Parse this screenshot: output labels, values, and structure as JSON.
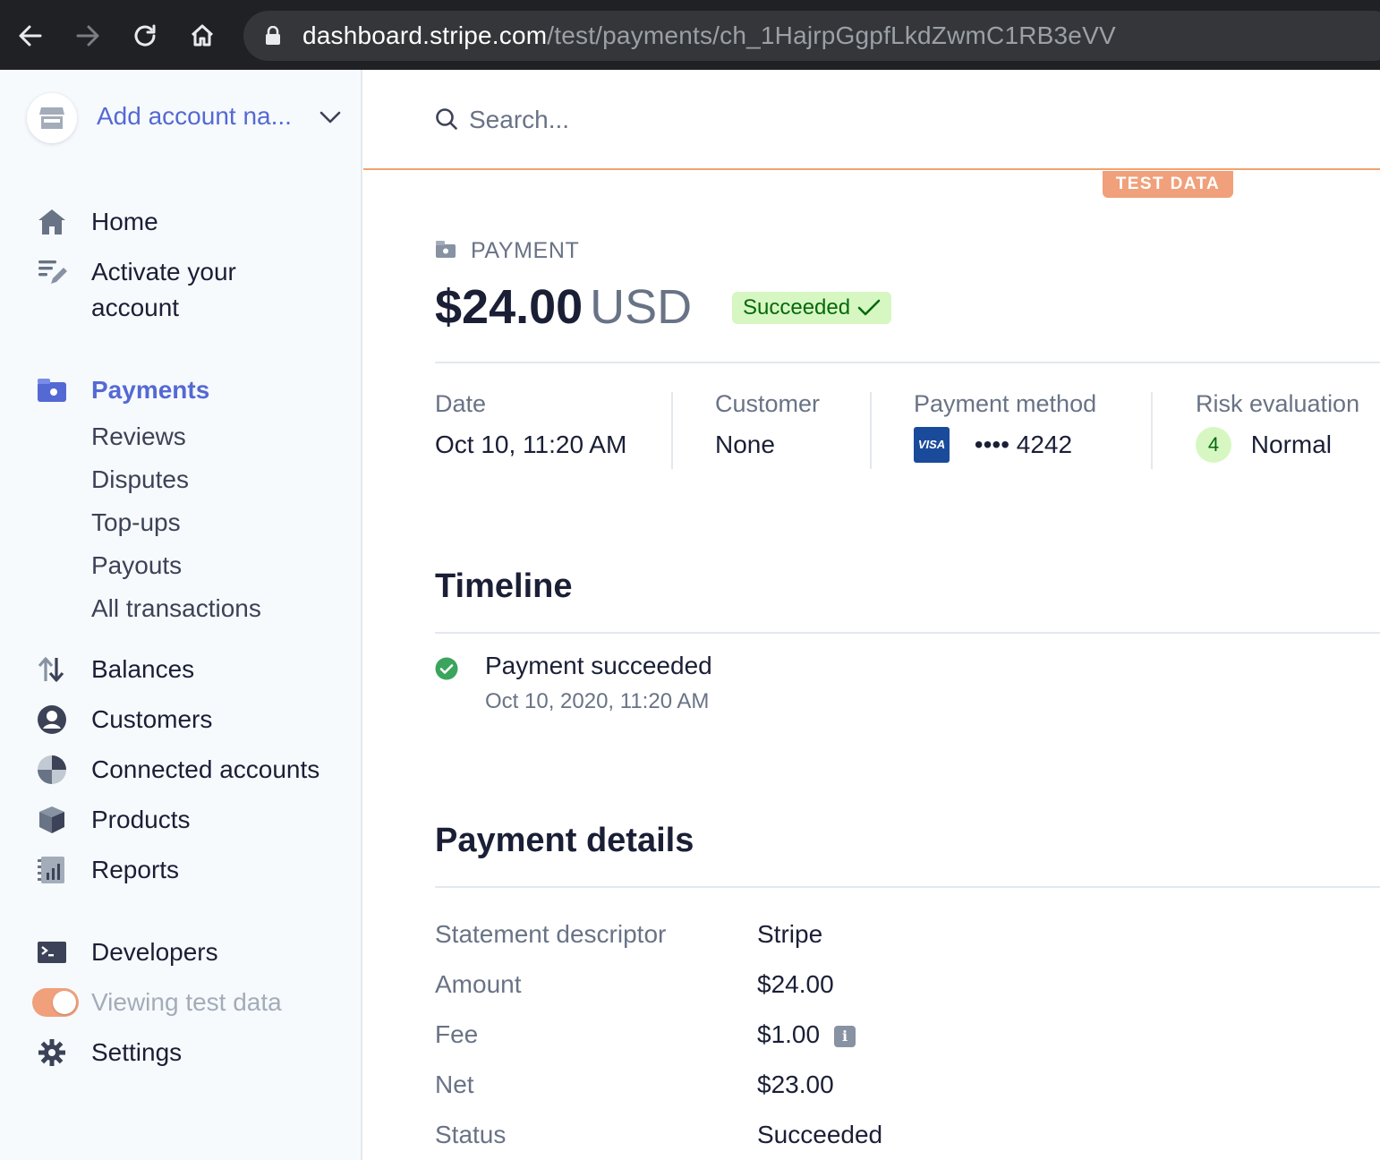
{
  "browser": {
    "url_host": "dashboard.stripe.com",
    "url_path": "/test/payments/ch_1HajrpGgpfLkdZwmC1RB3eVV"
  },
  "sidebar": {
    "account_name": "Add account na...",
    "items": {
      "home": "Home",
      "activate_line1": "Activate your",
      "activate_line2": "account",
      "payments": "Payments",
      "balances": "Balances",
      "customers": "Customers",
      "connected_accounts": "Connected accounts",
      "products": "Products",
      "reports": "Reports",
      "developers": "Developers",
      "viewing_test_data": "Viewing test data",
      "settings": "Settings"
    },
    "payments_sub": {
      "reviews": "Reviews",
      "disputes": "Disputes",
      "topups": "Top-ups",
      "payouts": "Payouts",
      "all_transactions": "All transactions"
    },
    "test_data_toggle_on": true
  },
  "search": {
    "placeholder": "Search..."
  },
  "test_badge": "TEST DATA",
  "payment": {
    "label": "PAYMENT",
    "amount": "$24.00",
    "currency": "USD",
    "status": "Succeeded"
  },
  "summary": {
    "date_label": "Date",
    "date_value": "Oct 10, 11:20 AM",
    "customer_label": "Customer",
    "customer_value": "None",
    "method_label": "Payment method",
    "card_brand": "VISA",
    "card_last4": "•••• 4242",
    "risk_label": "Risk evaluation",
    "risk_score": "4",
    "risk_value": "Normal"
  },
  "timeline": {
    "title": "Timeline",
    "event_title": "Payment succeeded",
    "event_date": "Oct 10, 2020, 11:20 AM"
  },
  "details": {
    "title": "Payment details",
    "rows": [
      {
        "label": "Statement descriptor",
        "value": "Stripe"
      },
      {
        "label": "Amount",
        "value": "$24.00"
      },
      {
        "label": "Fee",
        "value": "$1.00"
      },
      {
        "label": "Net",
        "value": "$23.00"
      },
      {
        "label": "Status",
        "value": "Succeeded"
      }
    ]
  },
  "colors": {
    "accent": "#5469d4",
    "test_orange": "#f0a07b",
    "success_bg": "#d7f7c2",
    "success_text": "#05690d"
  }
}
